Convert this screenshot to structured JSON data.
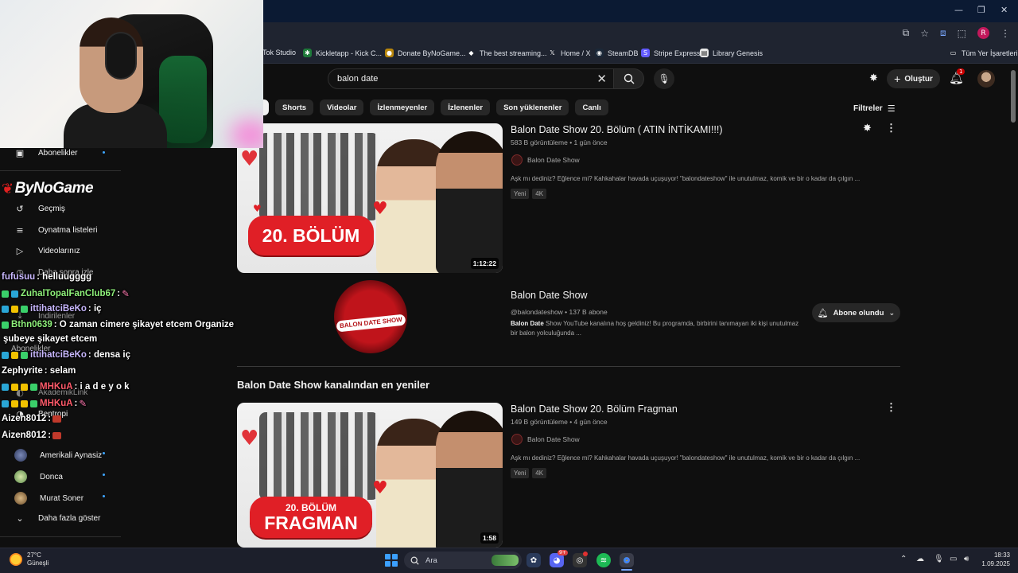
{
  "browser": {
    "bookmarks": [
      {
        "label": "Tok Studio"
      },
      {
        "label": "Kickletapp - Kick C..."
      },
      {
        "label": "Donate ByNoGame..."
      },
      {
        "label": "The best streaming..."
      },
      {
        "label": "Home / X"
      },
      {
        "label": "SteamDB"
      },
      {
        "label": "Stripe Express"
      },
      {
        "label": "Library Genesis"
      }
    ],
    "all_bookmarks": "Tüm Yer İşaretleri",
    "profile_initial": "R"
  },
  "header": {
    "search_query": "balon date",
    "create_label": "Oluştur",
    "notification_count": "1"
  },
  "chips": [
    "Shorts",
    "Videolar",
    "İzlenmeyenler",
    "İzlenenler",
    "Son yüklenenler",
    "Canlı"
  ],
  "filters_label": "Filtreler",
  "sidebar": {
    "subscriptions": "Abonelikler",
    "items": [
      {
        "label": "Geçmiş",
        "icon": "history-icon"
      },
      {
        "label": "Oynatma listeleri",
        "icon": "playlist-icon"
      },
      {
        "label": "Videolarınız",
        "icon": "video-icon"
      },
      {
        "label": "Daha sonra izle",
        "icon": "clock-icon"
      }
    ],
    "downloads": "İndirilenler",
    "subs_header": "Abonelikler",
    "channels_partial": [
      {
        "label": "AkademikLink"
      },
      {
        "label": "Bentropi"
      }
    ],
    "channels": [
      {
        "label": "Amerikali Aynasiz"
      },
      {
        "label": "Donca"
      },
      {
        "label": "Murat Soner"
      }
    ],
    "show_more": "Daha fazla göster"
  },
  "overlay": {
    "logo": "ByNoGame",
    "chat": [
      {
        "user": "fufusuu",
        "msg": " : helluugggg",
        "color": "#c9b8ff"
      },
      {
        "user": "ZuhalTopalFanClub67",
        "msg": " :",
        "color": "#8ef07a"
      },
      {
        "user": "ittihatciBeKo",
        "msg": " : iç",
        "color": "#c9b8ff"
      },
      {
        "user": "Bthn0639",
        "msg": " : O zaman cimere şikayet etcem Organize",
        "color": "#8ef07a"
      },
      {
        "user": "",
        "msg": "şubeye şikayet etcem",
        "color": "#ffffff"
      },
      {
        "user": "ittihatciBeKo",
        "msg": " : densa iç",
        "color": "#c9b8ff"
      },
      {
        "user": "Zephyrite",
        "msg": " : selam",
        "color": "#ffffff"
      },
      {
        "user": "MHKuA",
        "msg": " : i a d e y o k",
        "color": "#ff5a6a"
      },
      {
        "user": "MHKuA",
        "msg": " :",
        "color": "#ff5a6a"
      },
      {
        "user": "Aizen8012",
        "msg": " :",
        "color": "#ffffff"
      },
      {
        "user": "Aizen8012",
        "msg": " :",
        "color": "#ffffff"
      }
    ]
  },
  "results": {
    "video1": {
      "title": "Balon Date Show 20. Bölüm ( ATIN İNTİKAMI!!!)",
      "meta": "583 B görüntüleme • 1 gün önce",
      "channel": "Balon Date Show",
      "desc": "Aşk mı dediniz? Eğlence mi? Kahkahalar havada uçuşuyor! \"balondateshow\" ile unutulmaz, komik ve bir o kadar da çılgın ...",
      "tags": [
        "Yeni",
        "4K"
      ],
      "duration": "1:12:22",
      "thumb_text": "20. BÖLÜM"
    },
    "channel": {
      "name": "Balon Date Show",
      "meta": "@balondateshow • 137 B abone",
      "desc_bold": "Balon Date",
      "desc_line1": " Show YouTube kanalına hoş geldiniz! Bu programda, birbirini tanımayan iki kişi unutulmaz",
      "desc_line2": "bir balon yolculuğunda ...",
      "subscribed": "Abone olundu",
      "avatar_text": "BALON DATE SHOW"
    },
    "section_title": "Balon Date Show kanalından en yeniler",
    "video2": {
      "title": "Balon Date Show 20. Bölüm Fragman",
      "meta": "149 B görüntüleme • 4 gün önce",
      "channel": "Balon Date Show",
      "desc": "Aşk mı dediniz? Eğlence mi? Kahkahalar havada uçuşuyor! \"balondateshow\" ile unutulmaz, komik ve bir o kadar da çılgın ...",
      "tags": [
        "Yeni",
        "4K"
      ],
      "duration": "1:58",
      "thumb_text1": "20. BÖLÜM",
      "thumb_text2": "FRAGMAN"
    }
  },
  "taskbar": {
    "temp": "27°C",
    "weather": "Güneşli",
    "search": "Ara",
    "time": "18:33",
    "date": "1.09.2025",
    "discord_badge": "9+"
  }
}
